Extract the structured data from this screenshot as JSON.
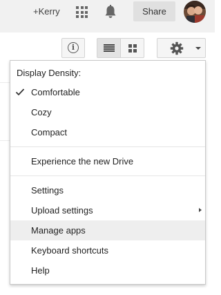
{
  "header": {
    "user_link": "+Kerry",
    "share_label": "Share",
    "icons": [
      "apps-grid-icon",
      "notifications-bell-icon",
      "avatar"
    ]
  },
  "toolbar": {
    "info_glyph": "i",
    "icons": [
      "info-icon",
      "list-view-icon",
      "grid-view-icon",
      "settings-gear-icon",
      "dropdown-caret-icon"
    ]
  },
  "settings_menu": {
    "density_heading": "Display Density:",
    "density_options": [
      {
        "label": "Comfortable",
        "checked": true
      },
      {
        "label": "Cozy",
        "checked": false
      },
      {
        "label": "Compact",
        "checked": false
      }
    ],
    "experience_label": "Experience the new Drive",
    "items": [
      {
        "label": "Settings"
      },
      {
        "label": "Upload settings",
        "has_submenu": true
      },
      {
        "label": "Manage apps",
        "highlighted": true
      },
      {
        "label": "Keyboard shortcuts"
      },
      {
        "label": "Help"
      }
    ]
  },
  "colors": {
    "topbar_bg": "#f1f1f1",
    "share_bg": "#e0e0e0",
    "highlight_bg": "#eeeeee",
    "menu_border": "#c9c9c9"
  }
}
